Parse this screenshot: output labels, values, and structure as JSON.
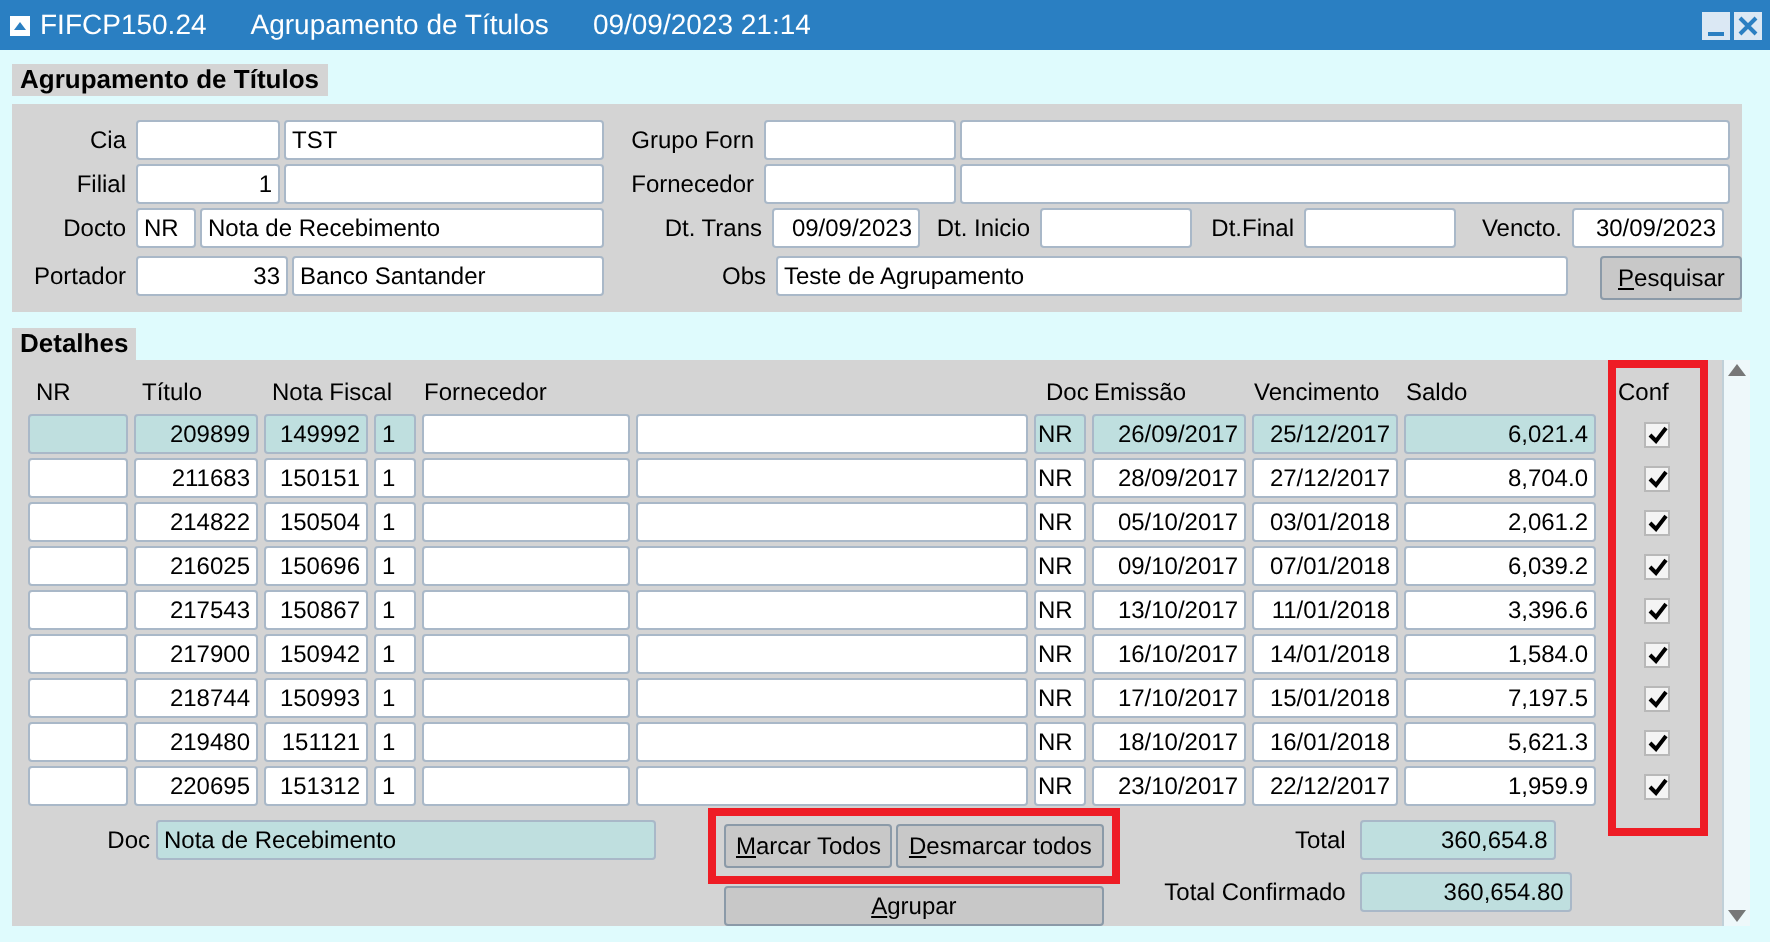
{
  "window": {
    "title": "FIFCP150.24",
    "subtitle": "Agrupamento de Títulos",
    "datetime": "09/09/2023 21:14"
  },
  "header": {
    "title": "Agrupamento de Títulos",
    "cia": {
      "label": "Cia",
      "name": "TST"
    },
    "filial": {
      "label": "Filial",
      "code": "1"
    },
    "docto": {
      "label": "Docto",
      "code": "NR",
      "name": "Nota de Recebimento"
    },
    "portador": {
      "label": "Portador",
      "code": "33",
      "name": "Banco Santander"
    },
    "grupo_forn": {
      "label": "Grupo Forn"
    },
    "fornecedor": {
      "label": "Fornecedor"
    },
    "dt_trans": {
      "label": "Dt. Trans",
      "value": "09/09/2023"
    },
    "dt_inicio": {
      "label": "Dt. Inicio"
    },
    "dt_final": {
      "label": "Dt.Final"
    },
    "vencto": {
      "label": "Vencto.",
      "value": "30/09/2023"
    },
    "obs": {
      "label": "Obs",
      "value": "Teste de Agrupamento"
    },
    "search_button": "Pesquisar"
  },
  "details": {
    "title": "Detalhes",
    "columns": [
      "NR",
      "Título",
      "Nota Fiscal",
      "Fornecedor",
      "Doc",
      "Emissão",
      "Vencimento",
      "Saldo",
      "Conf"
    ],
    "rows": [
      {
        "titulo": "209899",
        "nota_fiscal": "149992",
        "serie": "1",
        "doc": "NR",
        "emissao": "26/09/2017",
        "vencimento": "25/12/2017",
        "saldo": "6,021.4",
        "conf": true,
        "selected": true
      },
      {
        "titulo": "211683",
        "nota_fiscal": "150151",
        "serie": "1",
        "doc": "NR",
        "emissao": "28/09/2017",
        "vencimento": "27/12/2017",
        "saldo": "8,704.0",
        "conf": true,
        "selected": false
      },
      {
        "titulo": "214822",
        "nota_fiscal": "150504",
        "serie": "1",
        "doc": "NR",
        "emissao": "05/10/2017",
        "vencimento": "03/01/2018",
        "saldo": "2,061.2",
        "conf": true,
        "selected": false
      },
      {
        "titulo": "216025",
        "nota_fiscal": "150696",
        "serie": "1",
        "doc": "NR",
        "emissao": "09/10/2017",
        "vencimento": "07/01/2018",
        "saldo": "6,039.2",
        "conf": true,
        "selected": false
      },
      {
        "titulo": "217543",
        "nota_fiscal": "150867",
        "serie": "1",
        "doc": "NR",
        "emissao": "13/10/2017",
        "vencimento": "11/01/2018",
        "saldo": "3,396.6",
        "conf": true,
        "selected": false
      },
      {
        "titulo": "217900",
        "nota_fiscal": "150942",
        "serie": "1",
        "doc": "NR",
        "emissao": "16/10/2017",
        "vencimento": "14/01/2018",
        "saldo": "1,584.0",
        "conf": true,
        "selected": false
      },
      {
        "titulo": "218744",
        "nota_fiscal": "150993",
        "serie": "1",
        "doc": "NR",
        "emissao": "17/10/2017",
        "vencimento": "15/01/2018",
        "saldo": "7,197.5",
        "conf": true,
        "selected": false
      },
      {
        "titulo": "219480",
        "nota_fiscal": "151121",
        "serie": "1",
        "doc": "NR",
        "emissao": "18/10/2017",
        "vencimento": "16/01/2018",
        "saldo": "5,621.3",
        "conf": true,
        "selected": false
      },
      {
        "titulo": "220695",
        "nota_fiscal": "151312",
        "serie": "1",
        "doc": "NR",
        "emissao": "23/10/2017",
        "vencimento": "22/12/2017",
        "saldo": "1,959.9",
        "conf": true,
        "selected": false
      }
    ],
    "doc_label": "Doc",
    "doc_value": "Nota de Recebimento",
    "buttons": [
      "Marcar Todos",
      "Desmarcar todos"
    ],
    "group_button": "Agrupar",
    "total_label": "Total",
    "total": "360,654.8",
    "total_confirmed_label": "Total Confirmado",
    "total_confirmed": "360,654.80"
  }
}
